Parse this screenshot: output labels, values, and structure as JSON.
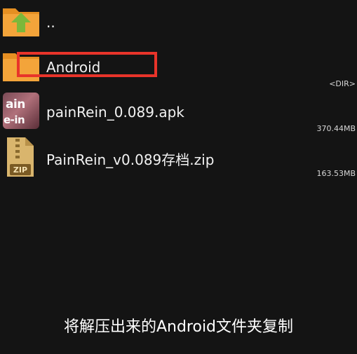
{
  "file_browser": {
    "items": [
      {
        "name": "..",
        "type": "parent-folder",
        "meta": "",
        "icon": "folder-up-icon"
      },
      {
        "name": "Android",
        "type": "folder",
        "meta": "<DIR>",
        "icon": "folder-icon",
        "highlighted": true
      },
      {
        "name": "painRein_0.089.apk",
        "type": "apk",
        "meta": "370.44MB",
        "icon": "apk-app-icon",
        "icon_text": [
          "ain",
          "e-in"
        ]
      },
      {
        "name": "PainRein_v0.089存档.zip",
        "type": "zip",
        "meta": "163.53MB",
        "icon": "zip-archive-icon",
        "icon_text": "ZIP"
      }
    ]
  },
  "colors": {
    "background": "#141414",
    "folder": "#f3a43a",
    "folder_tab": "#e58f22",
    "up_arrow": "#7cb83a",
    "highlight": "#e8342a",
    "zip_body": "#d9b56d"
  },
  "subtitle": "将解压出来的Android文件夹复制"
}
